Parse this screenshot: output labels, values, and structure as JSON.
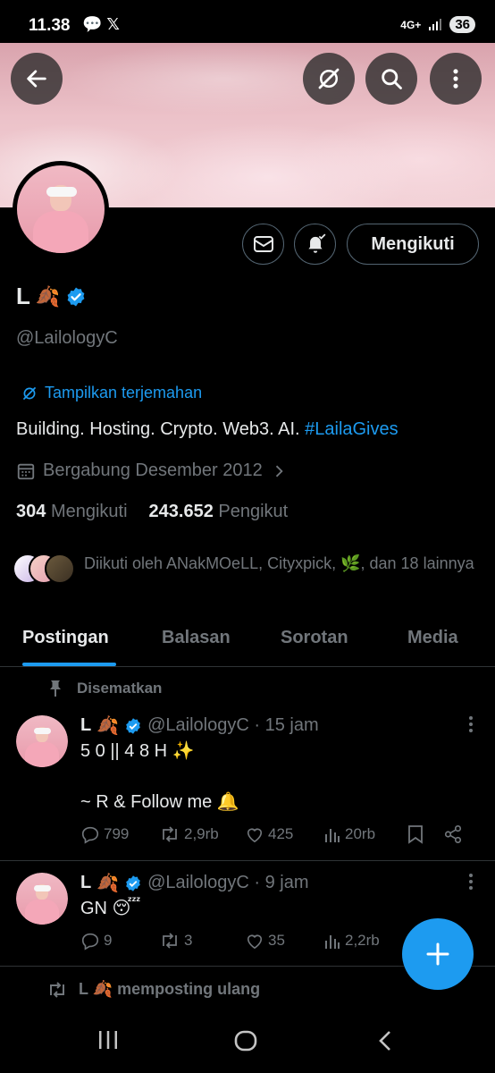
{
  "status_bar": {
    "time": "11.38",
    "battery": "36",
    "network": "4G+"
  },
  "profile": {
    "name": "L",
    "handle": "@LailologyC",
    "translate_label": "Tampilkan terjemahan",
    "bio_text": "Building. Hosting. Crypto. Web3. AI. ",
    "bio_hashtag": "#LailaGives",
    "joined": "Bergabung Desember 2012",
    "following_count": "304",
    "following_label": "Mengikuti",
    "followers_count": "243.652",
    "followers_label": "Pengikut",
    "followed_by": "Diikuti oleh ANakMOeLL, Cityxpick, 🌿, dan 18 lainnya",
    "follow_button": "Mengikuti"
  },
  "tabs": [
    {
      "label": "Postingan",
      "active": true
    },
    {
      "label": "Balasan",
      "active": false
    },
    {
      "label": "Sorotan",
      "active": false
    },
    {
      "label": "Media",
      "active": false
    }
  ],
  "posts": [
    {
      "pinned_label": "Disematkan",
      "name": "L",
      "handle_time": "@LailologyC · 15 jam",
      "text_line1": "5 0 || 4 8 H ✨",
      "text_line2": "~ R & Follow me 🔔",
      "replies": "799",
      "reposts": "2,9rb",
      "likes": "425",
      "views": "20rb"
    },
    {
      "name": "L",
      "handle_time": "@LailologyC · 9 jam",
      "text_line1": "GN 😴",
      "replies": "9",
      "reposts": "3",
      "likes": "35",
      "views": "2,2rb"
    }
  ],
  "repost_row": "L 🍂 memposting ulang",
  "colors": {
    "accent": "#1d9bf0",
    "background": "#000000",
    "muted": "#71767b",
    "text": "#e7e9ea"
  }
}
